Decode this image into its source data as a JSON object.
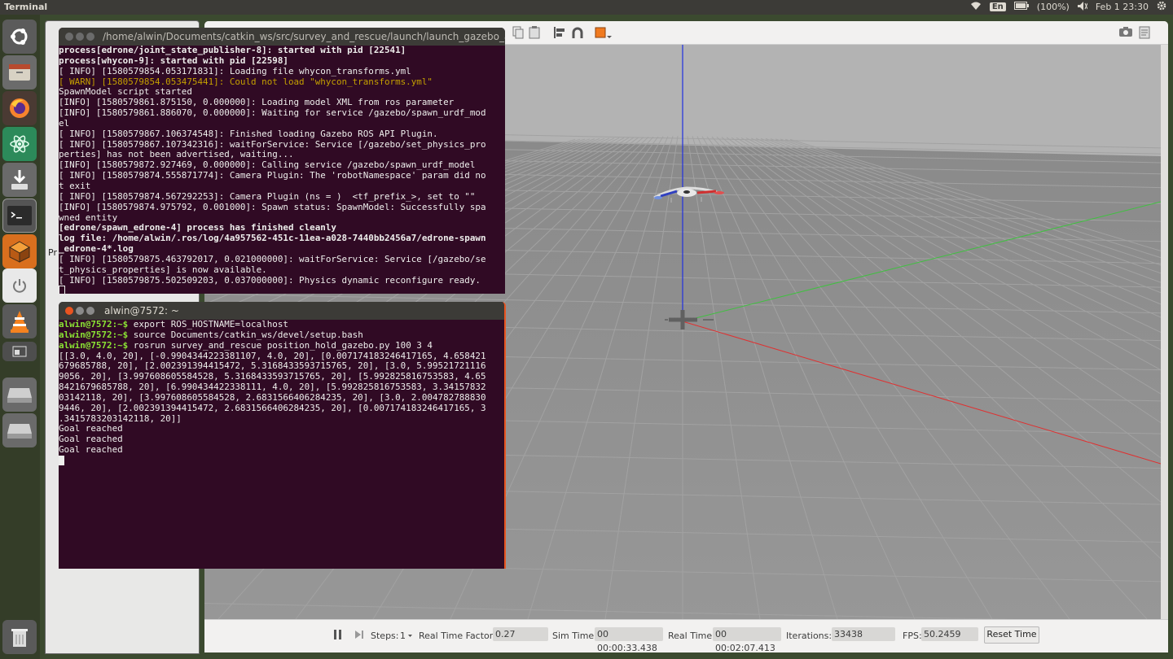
{
  "top_panel": {
    "app_title": "Terminal",
    "keyboard_layout": "En",
    "battery": "(100%)",
    "datetime": "Feb 1 23:30",
    "icons": [
      "wifi-icon",
      "keyboard-icon",
      "battery-icon",
      "volume-icon",
      "settings-gear-icon"
    ]
  },
  "launcher": {
    "items": [
      "ubuntu-dash-icon",
      "files-icon",
      "firefox-icon",
      "atom-icon",
      "installer-icon",
      "terminal-icon",
      "gazebo-icon",
      "power-icon",
      "vlc-icon",
      "workspace-icon",
      "drive-icon",
      "drive-icon",
      "trash-icon"
    ]
  },
  "background_window": {
    "label": "Pr"
  },
  "gazebo": {
    "status": {
      "steps_label": "Steps:",
      "steps_value": "1",
      "rtf_label": "Real Time Factor:",
      "rtf_value": "0.27",
      "sim_time_label": "Sim Time:",
      "sim_time_value": "00 00:00:33.438",
      "real_time_label": "Real Time:",
      "real_time_value": "00 00:02:07.413",
      "iterations_label": "Iterations:",
      "iterations_value": "33438",
      "fps_label": "FPS:",
      "fps_value": "50.2459",
      "reset_button": "Reset Time"
    },
    "colors": {
      "x_axis": "#e03030",
      "y_axis": "#40c040",
      "z_axis": "#2030e0",
      "ground": "#8e8e8e",
      "sky": "#b3b3b3"
    }
  },
  "terminal1": {
    "title": "/home/alwin/Documents/catkin_ws/src/survey_and_rescue/launch/launch_gazebo_and_w",
    "lines": [
      {
        "t": "process[edrone/joint_state_publisher-8]: started with pid [22541]",
        "c": "b"
      },
      {
        "t": "process[whycon-9]: started with pid [22598]",
        "c": "b"
      },
      {
        "t": "[ INFO] [1580579854.053171831]: Loading file whycon_transforms.yml",
        "c": ""
      },
      {
        "t": "[ WARN] [1580579854.053475441]: Could not load \"whycon_transforms.yml\"",
        "c": "warn"
      },
      {
        "t": "SpawnModel script started",
        "c": ""
      },
      {
        "t": "[INFO] [1580579861.875150, 0.000000]: Loading model XML from ros parameter",
        "c": ""
      },
      {
        "t": "[INFO] [1580579861.886070, 0.000000]: Waiting for service /gazebo/spawn_urdf_mod",
        "c": ""
      },
      {
        "t": "el",
        "c": ""
      },
      {
        "t": "[ INFO] [1580579867.106374548]: Finished loading Gazebo ROS API Plugin.",
        "c": ""
      },
      {
        "t": "[ INFO] [1580579867.107342316]: waitForService: Service [/gazebo/set_physics_pro",
        "c": ""
      },
      {
        "t": "perties] has not been advertised, waiting...",
        "c": ""
      },
      {
        "t": "[INFO] [1580579872.927469, 0.000000]: Calling service /gazebo/spawn_urdf_model",
        "c": ""
      },
      {
        "t": "[ INFO] [1580579874.555871774]: Camera Plugin: The 'robotNamespace' param did no",
        "c": ""
      },
      {
        "t": "t exit",
        "c": ""
      },
      {
        "t": "[ INFO] [1580579874.567292253]: Camera Plugin (ns = )  <tf_prefix_>, set to \"\"",
        "c": ""
      },
      {
        "t": "[INFO] [1580579874.975792, 0.001000]: Spawn status: SpawnModel: Successfully spa",
        "c": ""
      },
      {
        "t": "wned entity",
        "c": ""
      },
      {
        "t": "[edrone/spawn_edrone-4] process has finished cleanly",
        "c": "b"
      },
      {
        "t": "log file: /home/alwin/.ros/log/4a957562-451c-11ea-a028-7440bb2456a7/edrone-spawn",
        "c": "b"
      },
      {
        "t": "_edrone-4*.log",
        "c": "b"
      },
      {
        "t": "[ INFO] [1580579875.463792017, 0.021000000]: waitForService: Service [/gazebo/se",
        "c": ""
      },
      {
        "t": "t_physics_properties] is now available.",
        "c": ""
      },
      {
        "t": "[ INFO] [1580579875.502509203, 0.037000000]: Physics dynamic reconfigure ready.",
        "c": ""
      }
    ]
  },
  "terminal2": {
    "title": "alwin@7572: ~",
    "commands": [
      {
        "prompt": "alwin@7572:~$",
        "cmd": " export ROS_HOSTNAME=localhost"
      },
      {
        "prompt": "alwin@7572:~$",
        "cmd": " source Documents/catkin_ws/devel/setup.bash"
      },
      {
        "prompt": "alwin@7572:~$",
        "cmd": " rosrun survey_and_rescue position_hold_gazebo.py 100 3 4"
      }
    ],
    "output": [
      "[[3.0, 4.0, 20], [-0.9904344223381107, 4.0, 20], [0.007174183246417165, 4.658421",
      "679685788, 20], [2.002391394415472, 5.3168433593715765, 20], [3.0, 5.99521721116",
      "9056, 20], [3.997608605584528, 5.3168433593715765, 20], [5.992825816753583, 4.65",
      "8421679685788, 20], [6.990434422338111, 4.0, 20], [5.992825816753583, 3.34157832",
      "03142118, 20], [3.997608605584528, 2.6831566406284235, 20], [3.0, 2.004782788830",
      "9446, 20], [2.002391394415472, 2.6831566406284235, 20], [0.007174183246417165, 3",
      ".3415783203142118, 20]]",
      "Goal reached",
      "Goal reached",
      "Goal reached"
    ]
  }
}
